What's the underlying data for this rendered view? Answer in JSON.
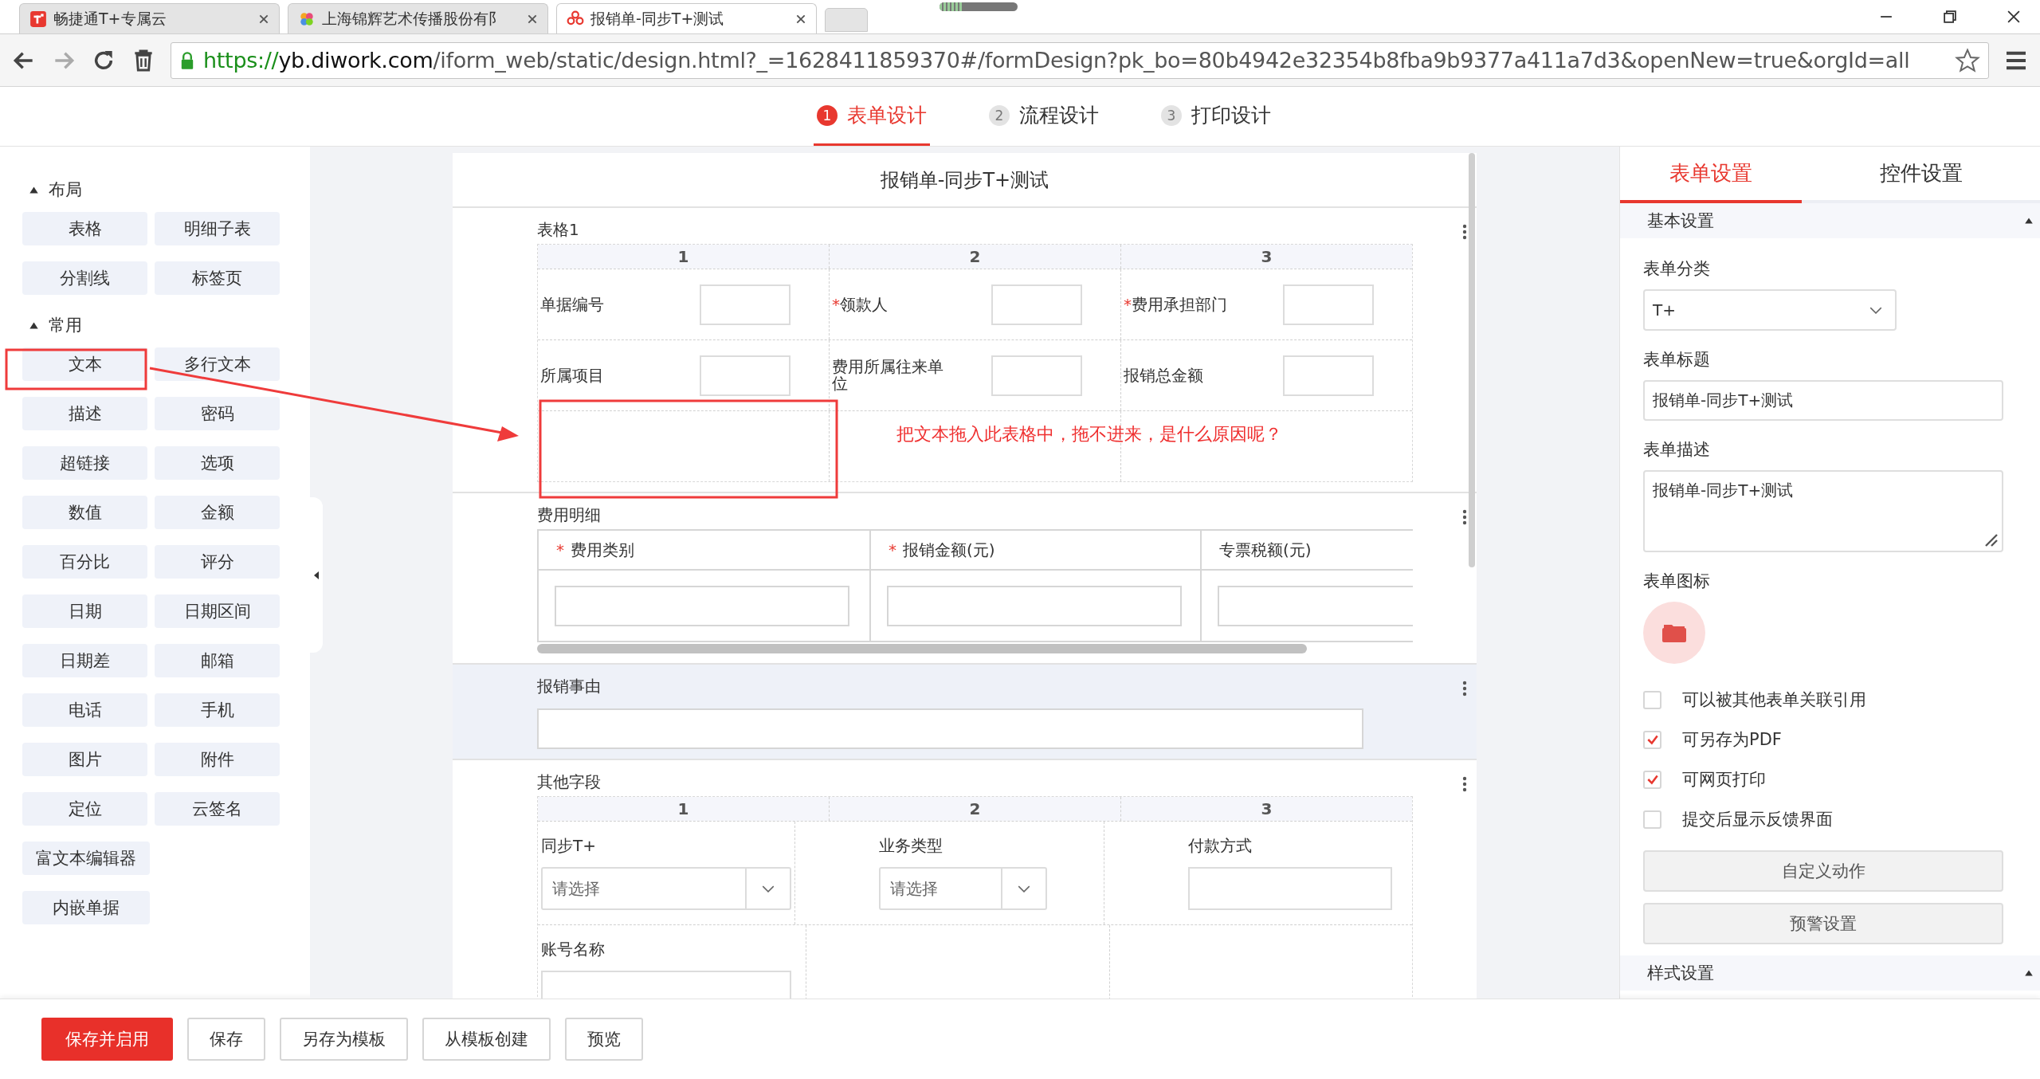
{
  "browser": {
    "tabs": [
      {
        "title": "畅捷通T+专属云",
        "kind": "t-logo",
        "selected": false
      },
      {
        "title": "上海锦辉艺术传播股份有阝",
        "kind": "petals",
        "selected": false
      },
      {
        "title": "报销单-同步T+测试",
        "kind": "ring",
        "selected": true
      }
    ],
    "url": {
      "scheme": "https://",
      "host": "yb.diwork.com",
      "path": "/iform_web/static/design.html?_=1628411859370#/formDesign?pk_bo=80b4942e32354b8fba9b9377a411a7d3&openNew=true&orgId=all"
    }
  },
  "steps": [
    {
      "number": "1",
      "label": "表单设计",
      "selected": true
    },
    {
      "number": "2",
      "label": "流程设计",
      "selected": false
    },
    {
      "number": "3",
      "label": "打印设计",
      "selected": false
    }
  ],
  "sidebar": {
    "groups": [
      {
        "title": "布局",
        "expanded": true,
        "items": [
          {
            "label": "表格",
            "kind": "half"
          },
          {
            "label": "明细子表",
            "kind": "half"
          },
          {
            "label": "分割线",
            "kind": "half"
          },
          {
            "label": "标签页",
            "kind": "half"
          }
        ]
      },
      {
        "title": "常用",
        "expanded": true,
        "items": [
          {
            "label": "文本",
            "kind": "half"
          },
          {
            "label": "多行文本",
            "kind": "half"
          },
          {
            "label": "描述",
            "kind": "half"
          },
          {
            "label": "密码",
            "kind": "half"
          },
          {
            "label": "超链接",
            "kind": "half"
          },
          {
            "label": "选项",
            "kind": "half"
          },
          {
            "label": "数值",
            "kind": "half"
          },
          {
            "label": "金额",
            "kind": "half"
          },
          {
            "label": "百分比",
            "kind": "half"
          },
          {
            "label": "评分",
            "kind": "half"
          },
          {
            "label": "日期",
            "kind": "half"
          },
          {
            "label": "日期区间",
            "kind": "half"
          },
          {
            "label": "日期差",
            "kind": "half"
          },
          {
            "label": "邮箱",
            "kind": "half"
          },
          {
            "label": "电话",
            "kind": "half"
          },
          {
            "label": "手机",
            "kind": "half"
          },
          {
            "label": "图片",
            "kind": "half"
          },
          {
            "label": "附件",
            "kind": "half"
          },
          {
            "label": "定位",
            "kind": "half"
          },
          {
            "label": "云签名",
            "kind": "half"
          },
          {
            "label": "富文本编辑器",
            "kind": "full"
          },
          {
            "label": "内嵌单据",
            "kind": "full"
          }
        ]
      }
    ]
  },
  "form": {
    "title": "报销单-同步T+测试",
    "sections": [
      {
        "kind": "grid",
        "label": "表格1",
        "selected": false,
        "columns": [
          "1",
          "2",
          "3"
        ],
        "rows": [
          [
            {
              "label": "单据编号",
              "kind": "box"
            },
            {
              "marker": "*",
              "label": "领款人",
              "kind": "box"
            },
            {
              "marker": "*",
              "label": "费用承担部门",
              "kind": "box"
            }
          ],
          [
            {
              "label": "所属项目",
              "kind": "box"
            },
            {
              "label": "费用所属往来单位",
              "kind": "box"
            },
            {
              "label": "报销总金额",
              "kind": "box"
            }
          ],
          [
            {
              "kind": "empty"
            },
            {
              "kind": "empty"
            },
            {
              "kind": "empty"
            }
          ]
        ]
      },
      {
        "kind": "detail",
        "label": "费用明细",
        "selected": false,
        "columns": [
          {
            "marker": "*",
            "label": "费用类别"
          },
          {
            "marker": "*",
            "label": "报销金额(元)"
          },
          {
            "label": "专票税额(元)"
          }
        ]
      },
      {
        "kind": "field",
        "label": "报销事由",
        "selected": true
      },
      {
        "kind": "grid",
        "label": "其他字段",
        "selected": false,
        "columns": [
          "1",
          "2",
          "3"
        ],
        "rows": [
          [
            {
              "label": "同步T+",
              "kind": "select",
              "placeholder": "请选择"
            },
            {
              "label": "业务类型",
              "kind": "select",
              "placeholder": "请选择"
            },
            {
              "label": "付款方式",
              "kind": "input"
            }
          ],
          [
            {
              "label": "账号名称",
              "kind": "input"
            },
            {
              "kind": "empty"
            },
            {
              "kind": "empty"
            }
          ]
        ]
      }
    ]
  },
  "annotation": {
    "text": "把文本拖入此表格中，拖不进来，是什么原因呢？"
  },
  "settings": {
    "tabs": [
      {
        "label": "表单设置",
        "selected": true
      },
      {
        "label": "控件设置",
        "selected": false
      }
    ],
    "basic": {
      "title": "基本设置",
      "expanded": true
    },
    "category": {
      "label": "表单分类",
      "value": "T+"
    },
    "form_title": {
      "label": "表单标题",
      "value": "报销单-同步T+测试"
    },
    "description": {
      "label": "表单描述",
      "value": "报销单-同步T+测试"
    },
    "icon_label": "表单图标",
    "options": [
      {
        "label": "可以被其他表单关联引用",
        "checked": false
      },
      {
        "label": "可另存为PDF",
        "checked": true
      },
      {
        "label": "可网页打印",
        "checked": true
      },
      {
        "label": "提交后显示反馈界面",
        "checked": false
      }
    ],
    "buttons": [
      "自定义动作",
      "预警设置"
    ],
    "style": {
      "title": "样式设置",
      "expanded": true
    }
  },
  "actions": [
    {
      "label": "保存并启用",
      "kind": "primary"
    },
    {
      "label": "保存",
      "kind": "default"
    },
    {
      "label": "另存为模板",
      "kind": "default"
    },
    {
      "label": "从模板创建",
      "kind": "default"
    },
    {
      "label": "预览",
      "kind": "default"
    }
  ]
}
